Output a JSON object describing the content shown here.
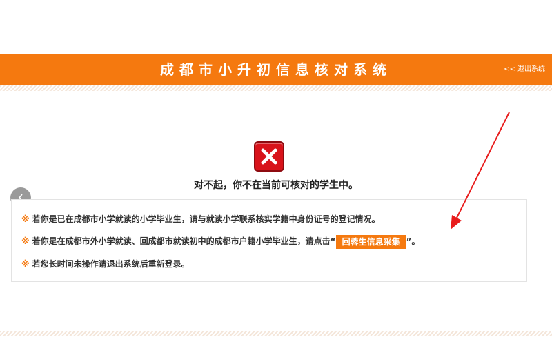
{
  "header": {
    "title": "成都市小升初信息核对系统",
    "logout_label": "<< 退出系统"
  },
  "nav": {
    "back_icon": "chevron-left-icon"
  },
  "result": {
    "icon": "error-x-icon",
    "message": "对不起，你不在当前可核对的学生中。"
  },
  "notices": {
    "mark": "※",
    "line1": "若你是已在成都市小学就读的小学毕业生，请与就读小学联系核实学籍中身份证号的登记情况。",
    "line2_before": "若你是在成都市外小学就读、回成都市就读初中的成都市户籍小学毕业生，请点击“",
    "line2_button": "回蓉生信息采集",
    "line2_after": "”。",
    "line3": "若您长时间未操作请退出系统后重新登录。"
  },
  "colors": {
    "accent": "#f5790f",
    "error": "#d8131b",
    "arrow": "#e81c1c"
  }
}
